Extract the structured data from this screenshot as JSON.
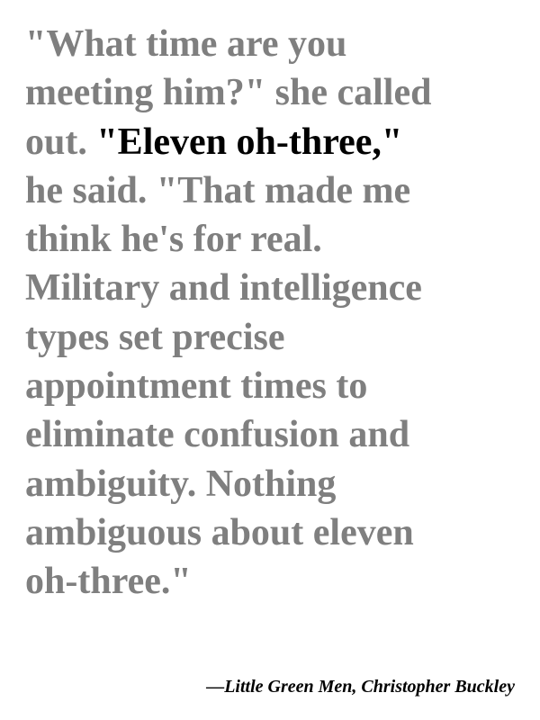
{
  "quote": {
    "lines": [
      "\"What time are you",
      "meeting him?\" she called",
      "out. ",
      "he said. \"That made me",
      "think he's for real.",
      "Military and intelligence",
      "types set precise",
      "appointment times to",
      "eliminate confusion and",
      "ambiguity. Nothing",
      "ambiguous about eleven",
      "oh-three.\""
    ],
    "highlight": "\"Eleven oh-three,\"",
    "text_color": "#7f7f7f",
    "highlight_color": "#000000"
  },
  "attribution": "—Little Green Men, Christopher Buckley"
}
